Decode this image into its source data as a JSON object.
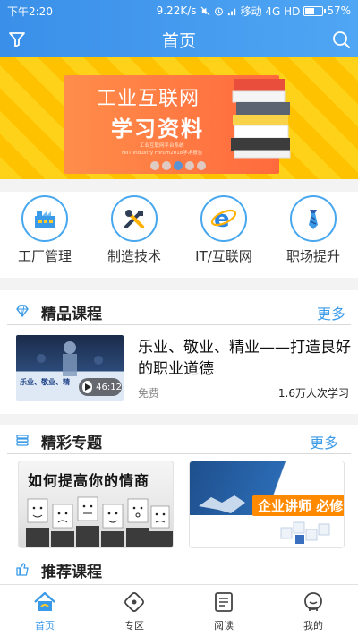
{
  "status_bar": {
    "time": "下午2:20",
    "speed": "9.22K/s",
    "carrier": "移动 4G HD",
    "battery": "57%",
    "battery_level": 0.57
  },
  "header": {
    "title": "首页",
    "filter_icon": "filter-icon",
    "search_icon": "search-icon"
  },
  "banner": {
    "line1": "工业互联网",
    "line2": "学习资料",
    "sub1": "工业互联网平台系统",
    "sub2": "NIIT Industry Forum2018学术报告",
    "slide_count": 5,
    "active_slide": 3
  },
  "categories": [
    {
      "label": "工厂管理",
      "icon": "factory-icon"
    },
    {
      "label": "制造技术",
      "icon": "tools-icon"
    },
    {
      "label": "IT/互联网",
      "icon": "browser-icon"
    },
    {
      "label": "职场提升",
      "icon": "tie-icon"
    }
  ],
  "featured": {
    "title": "精品课程",
    "more": "更多",
    "course": {
      "title": "乐业、敬业、精业——打造良好的职业道德",
      "thumb_text": "乐业、敬业、精",
      "duration": "46:12",
      "price": "免费",
      "learners": "1.6万人次学习"
    }
  },
  "topics": {
    "title": "精彩专题",
    "more": "更多",
    "items": [
      {
        "label": "如何提高你的情商"
      },
      {
        "label": "企业讲师 必修"
      }
    ]
  },
  "recommended": {
    "title": "推荐课程"
  },
  "tabs": [
    {
      "label": "首页",
      "icon": "home-icon",
      "active": true
    },
    {
      "label": "专区",
      "icon": "zone-icon",
      "active": false
    },
    {
      "label": "阅读",
      "icon": "book-icon",
      "active": false
    },
    {
      "label": "我的",
      "icon": "profile-icon",
      "active": false
    }
  ],
  "colors": {
    "primary": "#3a9ae8",
    "banner_yellow": "#ffd21a",
    "banner_orange": "#ff7a45"
  }
}
